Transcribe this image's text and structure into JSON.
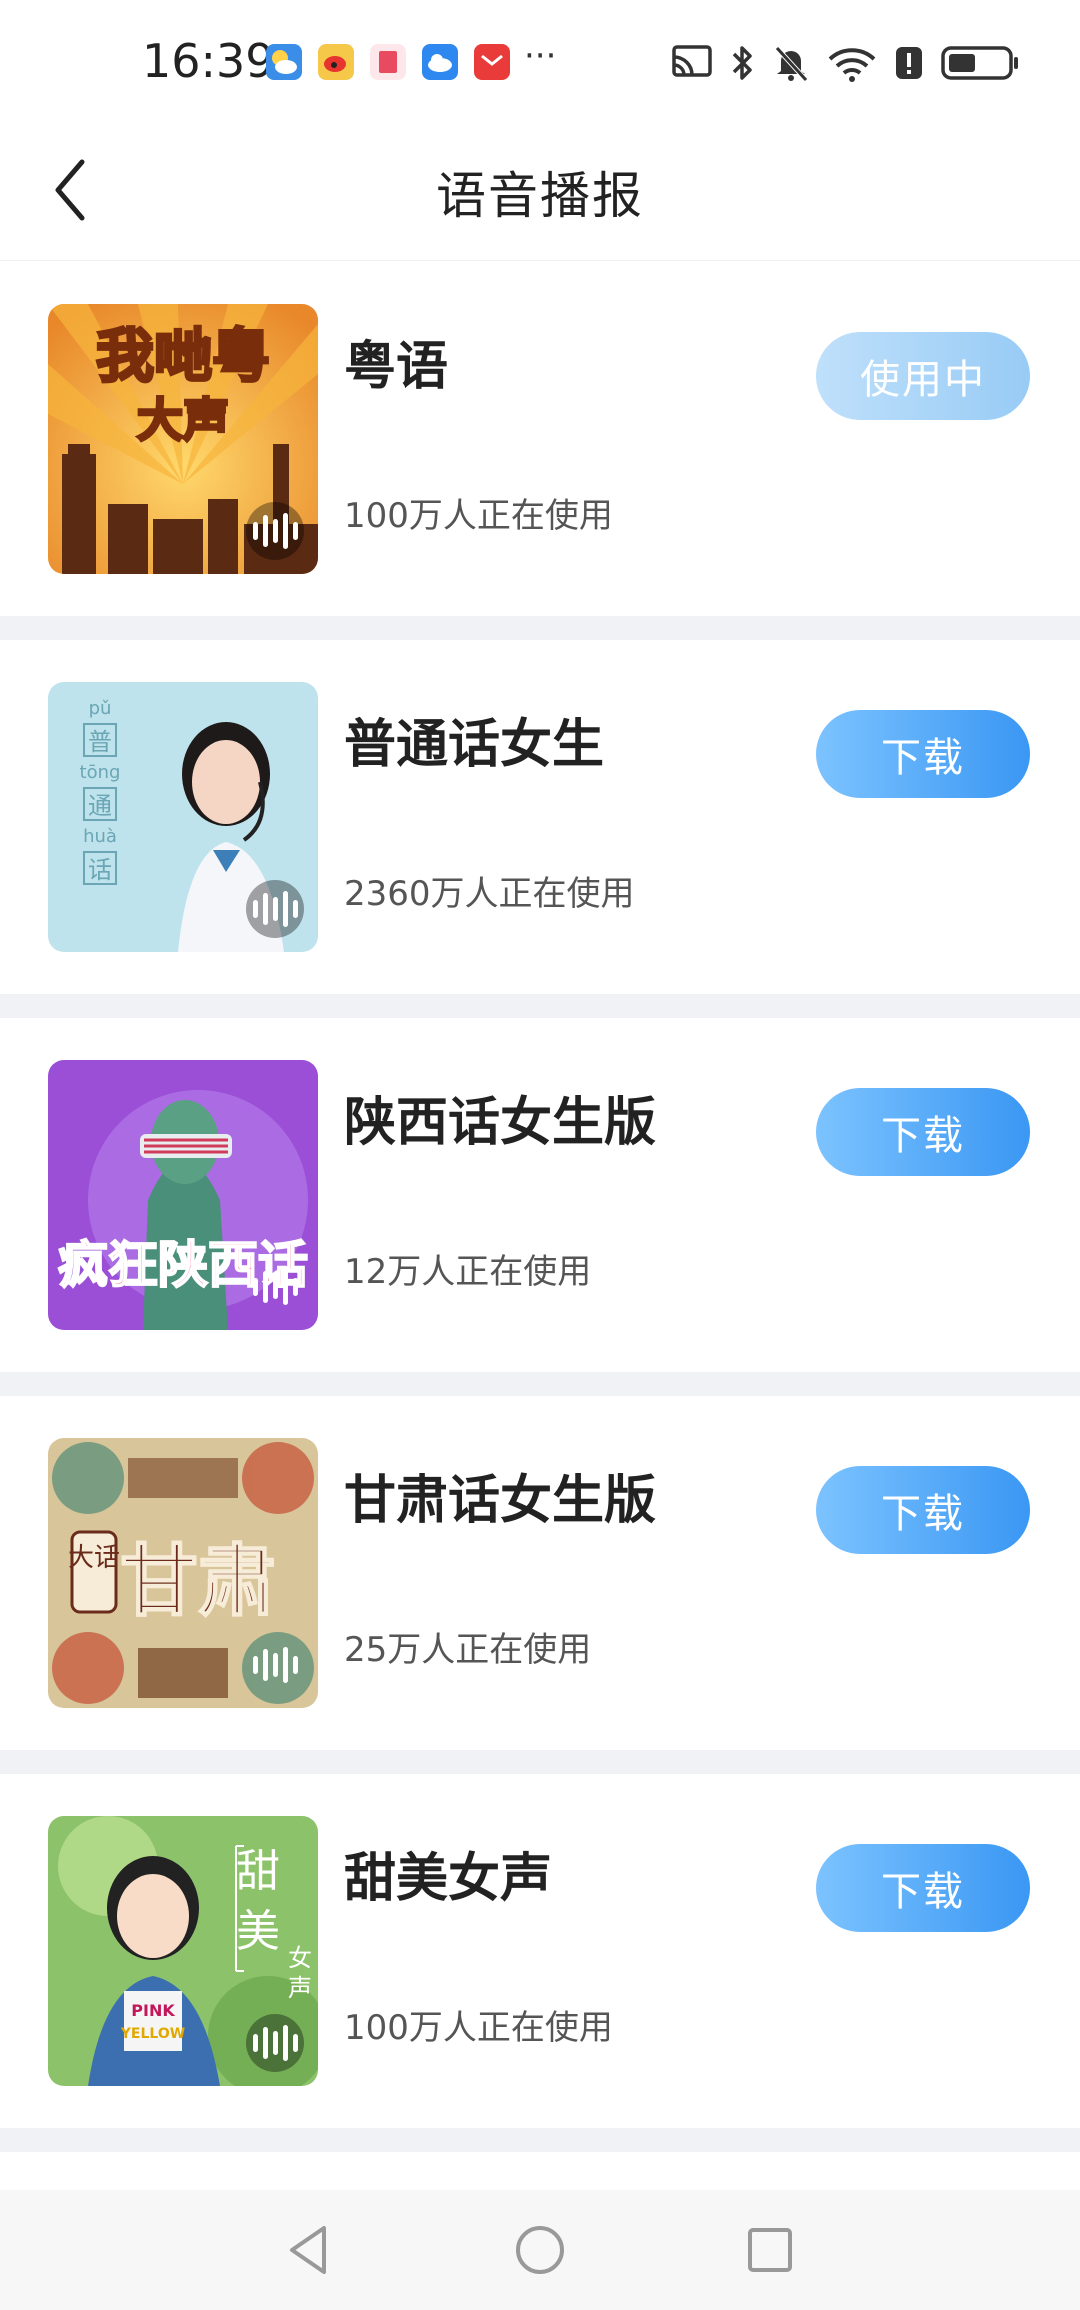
{
  "status_bar": {
    "time": "16:39",
    "more": "···",
    "notification_icons": [
      "weather-icon",
      "weibo-icon",
      "book-icon",
      "cloud-icon",
      "mail-icon"
    ],
    "system_icons": [
      "cast-icon",
      "bluetooth-icon",
      "mute-icon",
      "wifi-icon",
      "alert-icon",
      "battery-icon"
    ]
  },
  "header": {
    "title": "语音播报"
  },
  "voices": [
    {
      "name": "粤语",
      "users": "100万人正在使用",
      "action": "使用中",
      "in_use": true,
      "thumb_text": [
        "我哋粤",
        "大声"
      ]
    },
    {
      "name": "普通话女生",
      "users": "2360万人正在使用",
      "action": "下载",
      "in_use": false,
      "thumb_text": [
        "pǔ",
        "普",
        "tōng",
        "通",
        "huà",
        "话"
      ]
    },
    {
      "name": "陕西话女生版",
      "users": "12万人正在使用",
      "action": "下载",
      "in_use": false,
      "thumb_text": [
        "疯狂陕西话"
      ]
    },
    {
      "name": "甘肃话女生版",
      "users": "25万人正在使用",
      "action": "下载",
      "in_use": false,
      "thumb_text": [
        "大话",
        "甘肃"
      ]
    },
    {
      "name": "甜美女声",
      "users": "100万人正在使用",
      "action": "下载",
      "in_use": false,
      "thumb_text": [
        "甜",
        "美",
        "女",
        "声",
        "PINK",
        "YELLOW"
      ]
    }
  ],
  "colors": {
    "accent": "#3a97f3",
    "in_use": "#98cbf5",
    "separator": "#f0f2f5"
  }
}
